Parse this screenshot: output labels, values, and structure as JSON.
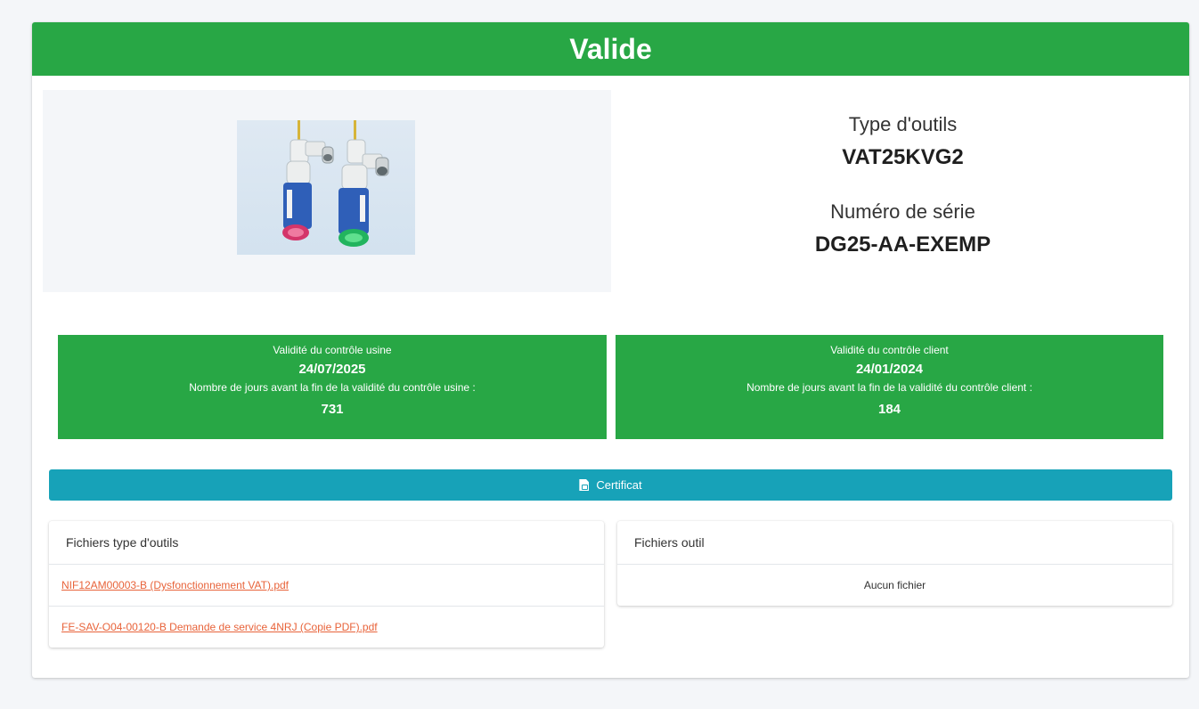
{
  "status": {
    "label": "Valide",
    "color": "#28a745"
  },
  "tool": {
    "type_label": "Type d'outils",
    "type_value": "VAT25KVG2",
    "serial_label": "Numéro de série",
    "serial_value": "DG25-AA-EXEMP"
  },
  "factory_control": {
    "title": "Validité du contrôle usine",
    "date": "24/07/2025",
    "days_label": "Nombre de jours avant la fin de la validité du contrôle usine :",
    "days_value": "731"
  },
  "client_control": {
    "title": "Validité du contrôle client",
    "date": "24/01/2024",
    "days_label": "Nombre de jours avant la fin de la validité du contrôle client :",
    "days_value": "184"
  },
  "certificate_button": {
    "label": "Certificat",
    "icon": "file-pdf-icon",
    "color": "#17a2b8"
  },
  "tool_type_files": {
    "header": "Fichiers type d'outils",
    "files": [
      "NIF12AM00003-B (Dysfonctionnement VAT).pdf",
      "FE-SAV-O04-00120-B  Demande de service 4NRJ (Copie PDF).pdf"
    ]
  },
  "tool_files": {
    "header": "Fichiers outil",
    "empty_text": "Aucun fichier"
  },
  "colors": {
    "link": "#e8633a",
    "background": "#f4f6f9"
  }
}
